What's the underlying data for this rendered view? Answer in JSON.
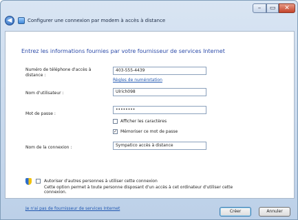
{
  "window": {
    "title": "Configurer une connexion par modem à accès à distance",
    "controls": {
      "minimize": "–",
      "maximize": "▭",
      "close": "✕"
    }
  },
  "heading": "Entrez les informations fournies par votre fournisseur de services Internet",
  "form": {
    "phone_label": "Numéro de téléphone d'accès à distance :",
    "phone_value": "403-555-4439",
    "dialing_rules_link": "Règles de numérotation",
    "username_label": "Nom d'utilisateur :",
    "username_value": "Ulrich098",
    "password_label": "Mot de passe :",
    "password_value": "••••••••",
    "show_chars_label": "Afficher les caractères",
    "show_chars_checked": false,
    "remember_pw_label": "Mémoriser ce mot de passe",
    "remember_pw_checked": true,
    "connection_name_label": "Nom de la connexion :",
    "connection_name_value": "Sympatico accès à distance",
    "allow_others_label": "Autoriser d'autres personnes à utiliser cette connexion",
    "allow_others_checked": false,
    "allow_others_desc": "Cette option permet à toute personne disposant d'un accès à cet ordinateur d'utiliser cette connexion.",
    "no_isp_link": "Je n'ai pas de fournisseur de services Internet"
  },
  "buttons": {
    "create": "Créer",
    "cancel": "Annuler"
  },
  "colors": {
    "heading": "#2b4aa8",
    "link": "#1f56b0",
    "frame": "#bcd0e8"
  }
}
